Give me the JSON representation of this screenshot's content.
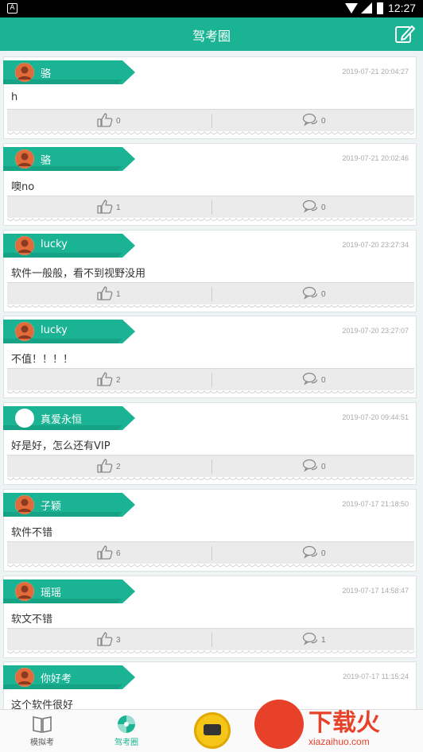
{
  "status_bar": {
    "time": "12:27",
    "left_icon_glyph": "A"
  },
  "header": {
    "title": "驾考圈"
  },
  "posts": [
    {
      "user": "骆",
      "time": "2019-07-21 20:04:27",
      "content": "h",
      "likes": "0",
      "comments": "0",
      "avatar": "person"
    },
    {
      "user": "骆",
      "time": "2019-07-21 20:02:46",
      "content": "噢no",
      "likes": "1",
      "comments": "0",
      "avatar": "person"
    },
    {
      "user": "lucky",
      "time": "2019-07-20 23:27:34",
      "content": "软件一般般，看不到视野没用",
      "likes": "1",
      "comments": "0",
      "avatar": "person"
    },
    {
      "user": "lucky",
      "time": "2019-07-20 23:27:07",
      "content": "不值！！！！",
      "likes": "2",
      "comments": "0",
      "avatar": "person"
    },
    {
      "user": "真爱永恒",
      "time": "2019-07-20 09:44:51",
      "content": "好是好，怎么还有VIP",
      "likes": "2",
      "comments": "0",
      "avatar": "blank"
    },
    {
      "user": "子颖",
      "time": "2019-07-17 21:18:50",
      "content": "软件不错",
      "likes": "6",
      "comments": "0",
      "avatar": "person"
    },
    {
      "user": "瑶瑶",
      "time": "2019-07-17 14:58:47",
      "content": "软文不错",
      "likes": "3",
      "comments": "1",
      "avatar": "person"
    },
    {
      "user": "你好考",
      "time": "2019-07-17 11:15:24",
      "content": "这个软件很好",
      "likes": "",
      "comments": "",
      "avatar": "person"
    }
  ],
  "bottom_nav": {
    "items": [
      {
        "label": "模拟考",
        "icon": "book-icon",
        "active": false
      },
      {
        "label": "驾考圈",
        "icon": "circle-community-icon",
        "active": true
      }
    ]
  },
  "watermark": {
    "brand": "下载火",
    "url": "xiazaihuo.com"
  },
  "colors": {
    "accent": "#1ab394",
    "tag_dark": "#14967b",
    "watermark": "#e8412a"
  }
}
